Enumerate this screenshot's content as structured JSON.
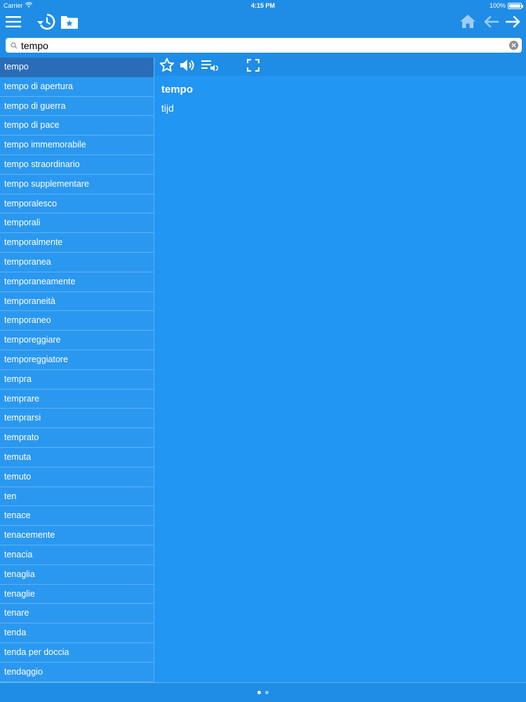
{
  "status": {
    "carrier": "Carrier",
    "time": "4:15 PM",
    "battery": "100%"
  },
  "toolbar": {
    "icons": [
      "menu-icon",
      "history-icon",
      "favorites-folder-icon",
      "home-icon",
      "back-arrow-icon",
      "forward-arrow-icon"
    ]
  },
  "search": {
    "value": "tempo",
    "placeholder": ""
  },
  "wordlist": {
    "items": [
      "tempo",
      "tempo di apertura",
      "tempo di guerra",
      "tempo di pace",
      "tempo immemorabile",
      "tempo straordinario",
      "tempo supplementare",
      "temporalesco",
      "temporali",
      "temporalmente",
      "temporanea",
      "temporaneamente",
      "temporaneità",
      "temporaneo",
      "temporeggiare",
      "temporeggiatore",
      "tempra",
      "temprare",
      "temprarsi",
      "temprato",
      "temuta",
      "temuto",
      "ten",
      "tenace",
      "tenacemente",
      "tenacia",
      "tenaglia",
      "tenaglie",
      "tenare",
      "tenda",
      "tenda per doccia",
      "tendaggio"
    ],
    "selected_index": 0
  },
  "detail": {
    "headword": "tempo",
    "translation": "tijd",
    "toolbar_icons": [
      "star-icon",
      "speaker-icon",
      "playlist-audio-icon",
      "fullscreen-icon"
    ]
  },
  "pager": {
    "pages": 2,
    "current": 0
  },
  "colors": {
    "background": "#2196f3",
    "header": "#1f8de6",
    "selected_row": "#2a6db6",
    "divider": "#5db3f5"
  }
}
